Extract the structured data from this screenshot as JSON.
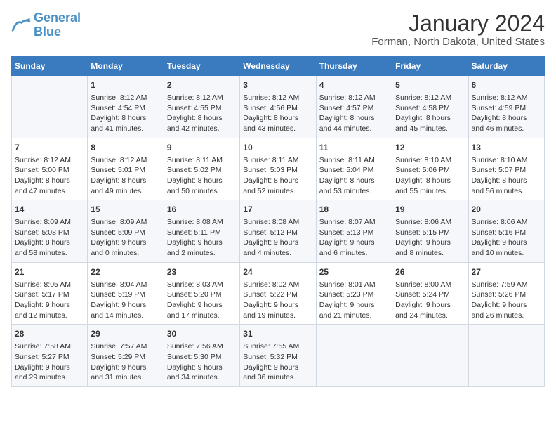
{
  "logo": {
    "text_general": "General",
    "text_blue": "Blue"
  },
  "title": "January 2024",
  "subtitle": "Forman, North Dakota, United States",
  "header_days": [
    "Sunday",
    "Monday",
    "Tuesday",
    "Wednesday",
    "Thursday",
    "Friday",
    "Saturday"
  ],
  "weeks": [
    [
      {
        "day": "",
        "content": ""
      },
      {
        "day": "1",
        "content": "Sunrise: 8:12 AM\nSunset: 4:54 PM\nDaylight: 8 hours\nand 41 minutes."
      },
      {
        "day": "2",
        "content": "Sunrise: 8:12 AM\nSunset: 4:55 PM\nDaylight: 8 hours\nand 42 minutes."
      },
      {
        "day": "3",
        "content": "Sunrise: 8:12 AM\nSunset: 4:56 PM\nDaylight: 8 hours\nand 43 minutes."
      },
      {
        "day": "4",
        "content": "Sunrise: 8:12 AM\nSunset: 4:57 PM\nDaylight: 8 hours\nand 44 minutes."
      },
      {
        "day": "5",
        "content": "Sunrise: 8:12 AM\nSunset: 4:58 PM\nDaylight: 8 hours\nand 45 minutes."
      },
      {
        "day": "6",
        "content": "Sunrise: 8:12 AM\nSunset: 4:59 PM\nDaylight: 8 hours\nand 46 minutes."
      }
    ],
    [
      {
        "day": "7",
        "content": "Sunrise: 8:12 AM\nSunset: 5:00 PM\nDaylight: 8 hours\nand 47 minutes."
      },
      {
        "day": "8",
        "content": "Sunrise: 8:12 AM\nSunset: 5:01 PM\nDaylight: 8 hours\nand 49 minutes."
      },
      {
        "day": "9",
        "content": "Sunrise: 8:11 AM\nSunset: 5:02 PM\nDaylight: 8 hours\nand 50 minutes."
      },
      {
        "day": "10",
        "content": "Sunrise: 8:11 AM\nSunset: 5:03 PM\nDaylight: 8 hours\nand 52 minutes."
      },
      {
        "day": "11",
        "content": "Sunrise: 8:11 AM\nSunset: 5:04 PM\nDaylight: 8 hours\nand 53 minutes."
      },
      {
        "day": "12",
        "content": "Sunrise: 8:10 AM\nSunset: 5:06 PM\nDaylight: 8 hours\nand 55 minutes."
      },
      {
        "day": "13",
        "content": "Sunrise: 8:10 AM\nSunset: 5:07 PM\nDaylight: 8 hours\nand 56 minutes."
      }
    ],
    [
      {
        "day": "14",
        "content": "Sunrise: 8:09 AM\nSunset: 5:08 PM\nDaylight: 8 hours\nand 58 minutes."
      },
      {
        "day": "15",
        "content": "Sunrise: 8:09 AM\nSunset: 5:09 PM\nDaylight: 9 hours\nand 0 minutes."
      },
      {
        "day": "16",
        "content": "Sunrise: 8:08 AM\nSunset: 5:11 PM\nDaylight: 9 hours\nand 2 minutes."
      },
      {
        "day": "17",
        "content": "Sunrise: 8:08 AM\nSunset: 5:12 PM\nDaylight: 9 hours\nand 4 minutes."
      },
      {
        "day": "18",
        "content": "Sunrise: 8:07 AM\nSunset: 5:13 PM\nDaylight: 9 hours\nand 6 minutes."
      },
      {
        "day": "19",
        "content": "Sunrise: 8:06 AM\nSunset: 5:15 PM\nDaylight: 9 hours\nand 8 minutes."
      },
      {
        "day": "20",
        "content": "Sunrise: 8:06 AM\nSunset: 5:16 PM\nDaylight: 9 hours\nand 10 minutes."
      }
    ],
    [
      {
        "day": "21",
        "content": "Sunrise: 8:05 AM\nSunset: 5:17 PM\nDaylight: 9 hours\nand 12 minutes."
      },
      {
        "day": "22",
        "content": "Sunrise: 8:04 AM\nSunset: 5:19 PM\nDaylight: 9 hours\nand 14 minutes."
      },
      {
        "day": "23",
        "content": "Sunrise: 8:03 AM\nSunset: 5:20 PM\nDaylight: 9 hours\nand 17 minutes."
      },
      {
        "day": "24",
        "content": "Sunrise: 8:02 AM\nSunset: 5:22 PM\nDaylight: 9 hours\nand 19 minutes."
      },
      {
        "day": "25",
        "content": "Sunrise: 8:01 AM\nSunset: 5:23 PM\nDaylight: 9 hours\nand 21 minutes."
      },
      {
        "day": "26",
        "content": "Sunrise: 8:00 AM\nSunset: 5:24 PM\nDaylight: 9 hours\nand 24 minutes."
      },
      {
        "day": "27",
        "content": "Sunrise: 7:59 AM\nSunset: 5:26 PM\nDaylight: 9 hours\nand 26 minutes."
      }
    ],
    [
      {
        "day": "28",
        "content": "Sunrise: 7:58 AM\nSunset: 5:27 PM\nDaylight: 9 hours\nand 29 minutes."
      },
      {
        "day": "29",
        "content": "Sunrise: 7:57 AM\nSunset: 5:29 PM\nDaylight: 9 hours\nand 31 minutes."
      },
      {
        "day": "30",
        "content": "Sunrise: 7:56 AM\nSunset: 5:30 PM\nDaylight: 9 hours\nand 34 minutes."
      },
      {
        "day": "31",
        "content": "Sunrise: 7:55 AM\nSunset: 5:32 PM\nDaylight: 9 hours\nand 36 minutes."
      },
      {
        "day": "",
        "content": ""
      },
      {
        "day": "",
        "content": ""
      },
      {
        "day": "",
        "content": ""
      }
    ]
  ]
}
